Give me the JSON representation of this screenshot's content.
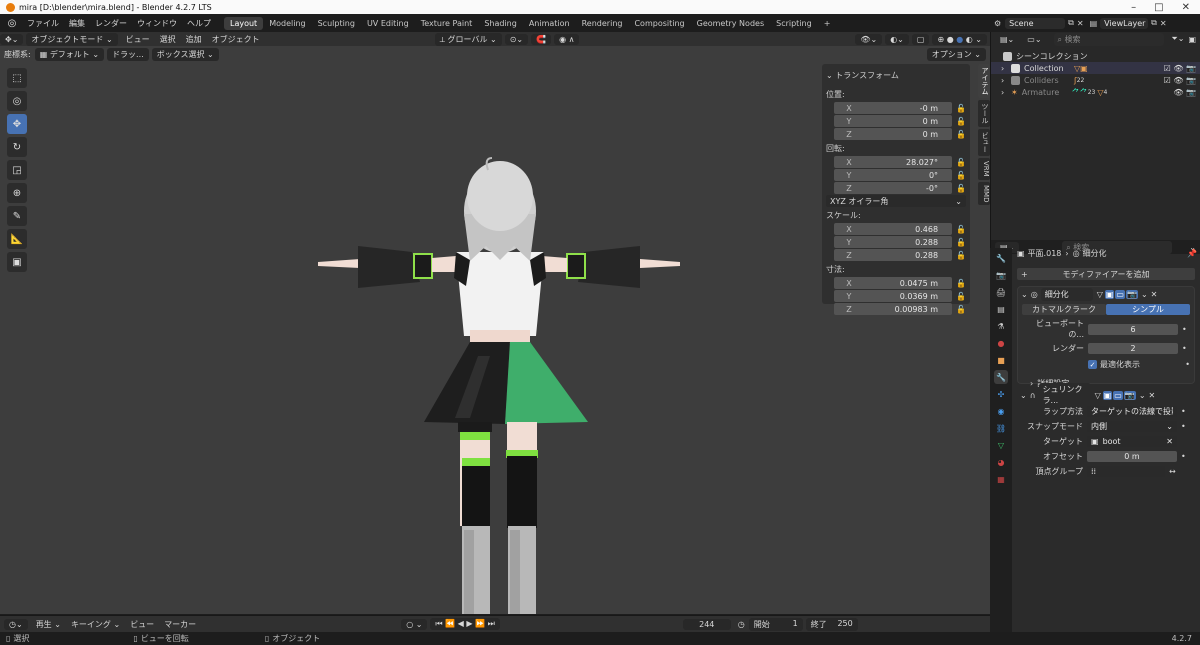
{
  "title": "mira [D:\\blender\\mira.blend] - Blender 4.2.7 LTS",
  "menu": [
    "ファイル",
    "編集",
    "レンダー",
    "ウィンドウ",
    "ヘルプ"
  ],
  "workspaces": [
    "Layout",
    "Modeling",
    "Sculpting",
    "UV Editing",
    "Texture Paint",
    "Shading",
    "Animation",
    "Rendering",
    "Compositing",
    "Geometry Nodes",
    "Scripting",
    "+"
  ],
  "scene": "Scene",
  "viewlayer": "ViewLayer",
  "vp_header": {
    "mode": "オブジェクトモード",
    "view": "ビュー",
    "select": "選択",
    "add": "追加",
    "object": "オブジェクト",
    "orientation": "グローバル",
    "options": "オプション"
  },
  "vp_header2": {
    "coord_label": "座標系:",
    "coord_value": "デフォルト",
    "drag_label": "ドラッ...",
    "select_box": "ボックス選択"
  },
  "npanel": {
    "title": "トランスフォーム",
    "location_label": "位置:",
    "location": [
      {
        "axis": "X",
        "value": "-0 m"
      },
      {
        "axis": "Y",
        "value": "0 m"
      },
      {
        "axis": "Z",
        "value": "0 m"
      }
    ],
    "rotation_label": "回転:",
    "rotation": [
      {
        "axis": "X",
        "value": "28.027°"
      },
      {
        "axis": "Y",
        "value": "0°"
      },
      {
        "axis": "Z",
        "value": "-0°"
      }
    ],
    "rotation_mode": "XYZ オイラー角",
    "scale_label": "スケール:",
    "scale": [
      {
        "axis": "X",
        "value": "0.468"
      },
      {
        "axis": "Y",
        "value": "0.288"
      },
      {
        "axis": "Z",
        "value": "0.288"
      }
    ],
    "dimensions_label": "寸法:",
    "dimensions": [
      {
        "axis": "X",
        "value": "0.0475 m"
      },
      {
        "axis": "Y",
        "value": "0.0369 m"
      },
      {
        "axis": "Z",
        "value": "0.00983 m"
      }
    ]
  },
  "side_tabs": [
    "アイテム",
    "ツール",
    "ビュー",
    "VRM",
    "MMD"
  ],
  "outliner": {
    "search_placeholder": "検索",
    "root": "シーンコレクション",
    "items": [
      {
        "name": "Collection",
        "badge": ""
      },
      {
        "name": "Colliders",
        "badge": "22"
      },
      {
        "name": "Armature",
        "badge": "23"
      }
    ],
    "armature_badge2": "4"
  },
  "properties": {
    "search_placeholder": "検索",
    "breadcrumb_object": "平面.018",
    "breadcrumb_modifier": "細分化",
    "add_modifier": "モディファイアーを追加",
    "subsurf": {
      "name": "細分化",
      "mode_catmull": "カトマルクラーク",
      "mode_simple": "シンプル",
      "viewport_label": "ビューポートの...",
      "viewport_value": "6",
      "render_label": "レンダー",
      "render_value": "2",
      "optimal_label": "最適化表示",
      "advanced_label": "詳細設定"
    },
    "shrinkwrap": {
      "name": "シュリンクラ...",
      "wrap_label": "ラップ方法",
      "wrap_value": "ターゲットの法線で投影",
      "snap_label": "スナップモード",
      "snap_value": "内側",
      "target_label": "ターゲット",
      "target_value": "boot",
      "offset_label": "オフセット",
      "offset_value": "0 m",
      "vgroup_label": "頂点グループ"
    }
  },
  "timeline": {
    "playback": "再生",
    "keying": "キーイング",
    "view": "ビュー",
    "marker": "マーカー",
    "current_frame": "244",
    "start_label": "開始",
    "start_value": "1",
    "end_label": "終了",
    "end_value": "250"
  },
  "status": {
    "select": "選択",
    "rotate_view": "ビューを回転",
    "object": "オブジェクト",
    "version": "4.2.7"
  },
  "colors": {
    "accent": "#4772b3",
    "viewport_bg": "#3d3d3d",
    "skirt_green": "#3fae6b",
    "trim_green": "#7fe040"
  }
}
